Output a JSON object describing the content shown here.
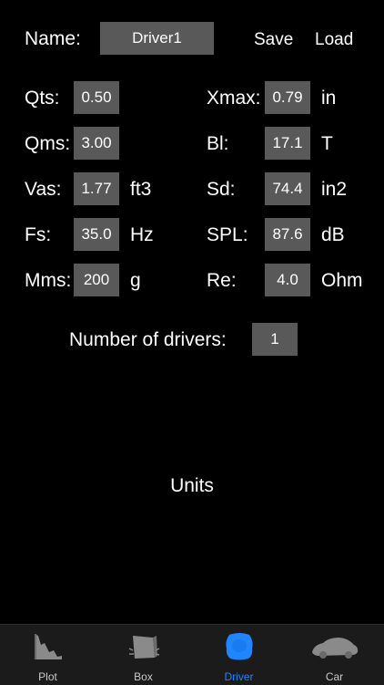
{
  "header": {
    "name_label": "Name:",
    "name_value": "Driver1",
    "save_label": "Save",
    "load_label": "Load"
  },
  "params": {
    "qts": {
      "label": "Qts:",
      "value": "0.50",
      "unit": ""
    },
    "qms": {
      "label": "Qms:",
      "value": "3.00",
      "unit": ""
    },
    "vas": {
      "label": "Vas:",
      "value": "1.77",
      "unit": "ft3"
    },
    "fs": {
      "label": "Fs:",
      "value": "35.0",
      "unit": "Hz"
    },
    "mms": {
      "label": "Mms:",
      "value": "200",
      "unit": "g"
    },
    "xmax": {
      "label": "Xmax:",
      "value": "0.79",
      "unit": "in"
    },
    "bl": {
      "label": "Bl:",
      "value": "17.1",
      "unit": "T"
    },
    "sd": {
      "label": "Sd:",
      "value": "74.4",
      "unit": "in2"
    },
    "spl": {
      "label": "SPL:",
      "value": "87.6",
      "unit": "dB"
    },
    "re": {
      "label": "Re:",
      "value": "4.0",
      "unit": "Ohm"
    }
  },
  "drivers": {
    "label": "Number of drivers:",
    "value": "1"
  },
  "units_label": "Units",
  "tabs": [
    {
      "label": "Plot",
      "icon": "plot-icon"
    },
    {
      "label": "Box",
      "icon": "box-icon"
    },
    {
      "label": "Driver",
      "icon": "driver-icon",
      "active": true
    },
    {
      "label": "Car",
      "icon": "car-icon"
    }
  ],
  "colors": {
    "accent": "#1f86ff",
    "field_bg": "#595959",
    "background": "#000000"
  }
}
